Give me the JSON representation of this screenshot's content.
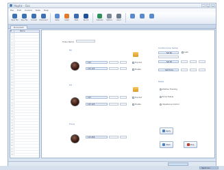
{
  "window": {
    "title": "Haptic - Gui",
    "minimize": "–",
    "maximize": "□",
    "close": "×"
  },
  "menu": [
    "File",
    "Edit",
    "Control",
    "Data",
    "Help"
  ],
  "toolbar": [
    {
      "label": "Open File",
      "color": "#3d6fb5"
    },
    {
      "label": "Save File",
      "color": "#3d6fb5"
    },
    {
      "label": "Connect",
      "color": "#3d6fb5"
    },
    {
      "label": "Disconnect",
      "color": "#3d6fb5"
    },
    {
      "label": "Setup",
      "color": "#5a8acb"
    },
    {
      "label": "Graph",
      "color": "#e07a2c"
    },
    {
      "label": "Stats",
      "color": "#3a6bb0"
    },
    {
      "label": "Record",
      "color": "#1f4f9a"
    },
    {
      "label": "Calibrate",
      "color": "#2f8f5a"
    },
    {
      "label": "Options",
      "color": "#7a8898"
    },
    {
      "label": "About",
      "color": "#6a7a8a"
    }
  ],
  "toolbar_extra": [
    {
      "color": "#5a8acb"
    },
    {
      "color": "#5a8acb"
    },
    {
      "color": "#5a8acb"
    }
  ],
  "tab": {
    "label": "Document"
  },
  "left_panel": {
    "header": [
      "#",
      "Name"
    ],
    "rows": [
      "1",
      "2",
      "3",
      "4",
      "5",
      "6",
      "7",
      "8",
      "9",
      "10",
      "11",
      "12",
      "13",
      "14",
      "15",
      "16",
      "17",
      "18",
      "19",
      "20",
      "21",
      "22",
      "23",
      "24",
      "25",
      "26",
      "27",
      "28",
      "29",
      "30",
      "31",
      "32",
      "33",
      "34",
      "35",
      "36",
      "37",
      "38",
      "39",
      "40",
      "41",
      "42",
      "43"
    ]
  },
  "main": {
    "top_field": "Probe Name",
    "group1": {
      "label": "Kp",
      "field1": "123",
      "field2": "123 123",
      "check1": "Top Out",
      "check2": "Enable"
    },
    "group2": {
      "label": "Kd",
      "field1": "123",
      "field2": "123 123",
      "check1": "Top Out",
      "check2": "Enable"
    },
    "group3": {
      "label": "Force",
      "field1": "123.456"
    },
    "right": {
      "title": "Control Loop Setup",
      "row1_btn": "Set Kp",
      "row1_check": "Auto",
      "row2_btn": "Set Kd",
      "row3_btn": "Set Force",
      "opt_title": "Mode",
      "opt1": "Position Tracking",
      "opt2": "Force Follow",
      "opt3": "Impedance Control"
    },
    "buttons": {
      "apply": "Apply",
      "start": "Start",
      "stop": "Stop"
    },
    "colors": {
      "apply": "#4a7fc1",
      "start": "#4a7fc1",
      "stop": "#c0392b"
    }
  },
  "status": {
    "text": ""
  },
  "taskbar": {
    "item": "Haptic Gui"
  }
}
